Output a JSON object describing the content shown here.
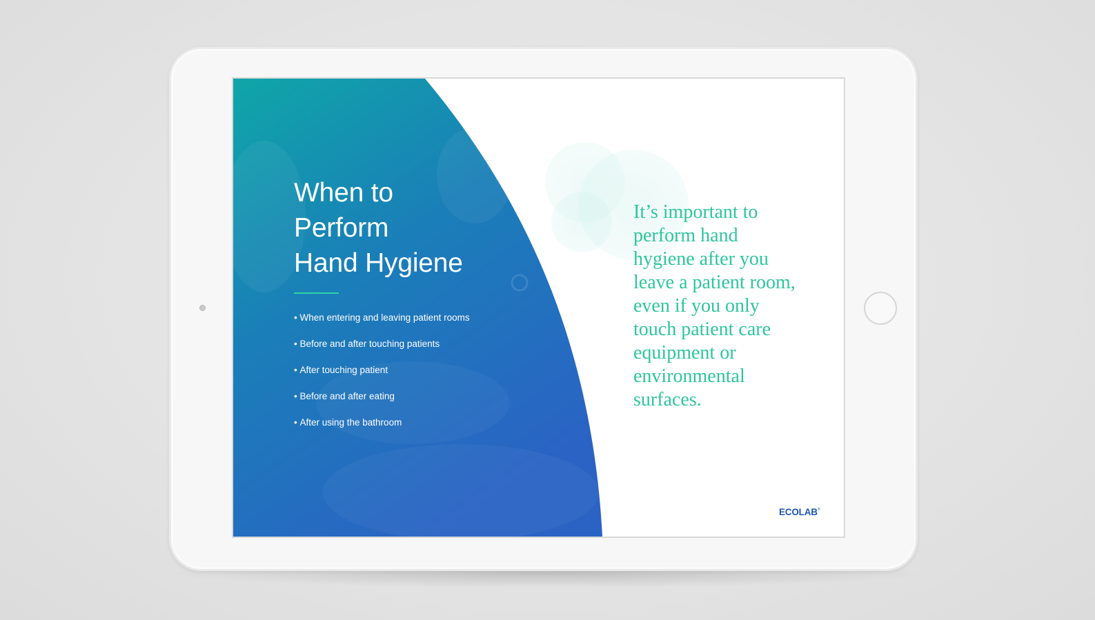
{
  "slide": {
    "title_lines": [
      "When to",
      "Perform",
      "Hand Hygiene"
    ],
    "bullets": [
      "When entering and leaving patient rooms",
      "Before and after touching patients",
      "After touching patient",
      "Before and after eating",
      "After using the bathroom"
    ],
    "quote_lines": [
      "It’s important to",
      "perform hand",
      "hygiene after you",
      "leave a patient room,",
      "even if you only",
      "touch patient care",
      "equipment or",
      "environmental",
      "surfaces."
    ],
    "logo": "ECOLAB"
  },
  "colors": {
    "gradient_top": "#0fa6a8",
    "gradient_bottom": "#2a63c4",
    "accent_green": "#2ed3a2",
    "quote_text": "#2dc59e",
    "logo_blue": "#1d56b8",
    "bubble_tint": "#c8efe8"
  }
}
